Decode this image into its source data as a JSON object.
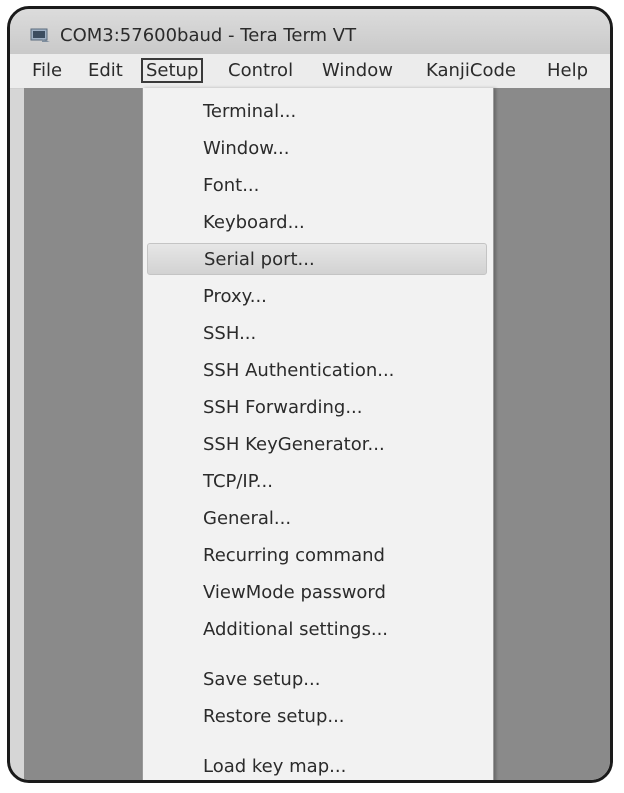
{
  "window": {
    "title": "COM3:57600baud - Tera Term VT"
  },
  "menubar": {
    "items": [
      "File",
      "Edit",
      "Setup",
      "Control",
      "Window",
      "KanjiCode",
      "Help"
    ],
    "active": "Setup"
  },
  "setup_menu": {
    "items": [
      "Terminal...",
      "Window...",
      "Font...",
      "Keyboard...",
      "Serial port...",
      "Proxy...",
      "SSH...",
      "SSH Authentication...",
      "SSH Forwarding...",
      "SSH KeyGenerator...",
      "TCP/IP...",
      "General...",
      "Recurring command",
      "ViewMode password",
      "Additional settings...",
      "Save setup...",
      "Restore setup...",
      "Load key map..."
    ],
    "highlighted": "Serial port..."
  },
  "icons": {
    "app": "terminal-app-icon"
  },
  "colors": {
    "menu_background": "#f2f2f2",
    "terminal_background": "#8a8a8a",
    "highlight": "#d8d8d8"
  }
}
